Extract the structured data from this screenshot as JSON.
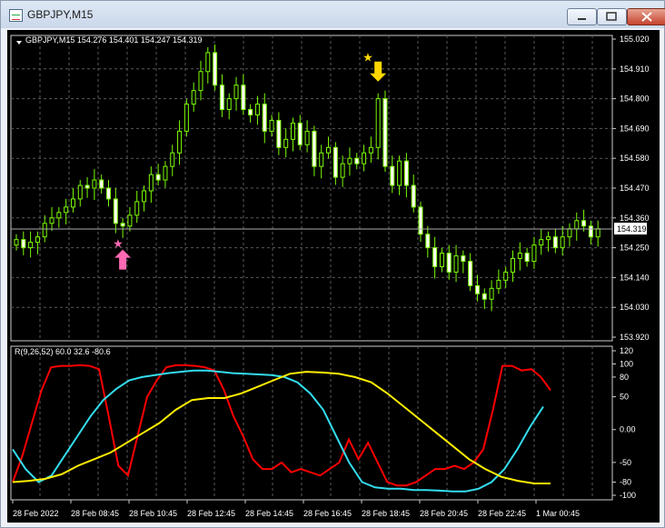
{
  "window": {
    "title": "GBPJPY,M15",
    "buttons": [
      "minimize",
      "maximize",
      "close"
    ]
  },
  "chart": {
    "header": "GBPJPY,M15  154.276 154.401 154.247 154.319",
    "price_axis": [
      "155.020",
      "154.910",
      "154.800",
      "154.690",
      "154.580",
      "154.470",
      "154.360",
      "154.250",
      "154.140",
      "154.030",
      "153.920"
    ],
    "current_price": "154.319",
    "time_axis": [
      "28 Feb 2022",
      "28 Feb 08:45",
      "28 Feb 10:45",
      "28 Feb 12:45",
      "28 Feb 14:45",
      "28 Feb 16:45",
      "28 Feb 18:45",
      "28 Feb 20:45",
      "28 Feb 22:45",
      "1 Mar 00:45"
    ],
    "indicator_header": "R(9,26,52) 60.0 32.6 -80.6",
    "indicator_axis": [
      "120",
      "100",
      "80",
      "50",
      "0.00",
      "-50",
      "-80",
      "-100"
    ]
  },
  "colors": {
    "background": "#000000",
    "candle": "#7CFC00",
    "grid": "#5a5a5a",
    "red_line": "#ff0000",
    "cyan_line": "#33ddee",
    "yellow_line": "#ffee00",
    "buy_arrow": "#ff69b4",
    "sell_arrow": "#ffd700"
  },
  "icons": {
    "buy": "pink-up-arrow-icon",
    "sell": "yellow-down-arrow-icon",
    "star": "star-icon"
  },
  "chart_data": {
    "type": "candlestick",
    "symbol": "GBPJPY",
    "timeframe": "M15",
    "ohlc_last": {
      "open": 154.276,
      "high": 154.401,
      "low": 154.247,
      "close": 154.319
    },
    "ylim": [
      153.92,
      155.02
    ],
    "close": [
      154.28,
      154.25,
      154.27,
      154.29,
      154.34,
      154.36,
      154.38,
      154.4,
      154.43,
      154.48,
      154.47,
      154.5,
      154.47,
      154.43,
      154.34,
      154.33,
      154.37,
      154.42,
      154.46,
      154.52,
      154.5,
      154.55,
      154.6,
      154.68,
      154.78,
      154.83,
      154.9,
      154.97,
      154.85,
      154.76,
      154.8,
      154.85,
      154.76,
      154.74,
      154.78,
      154.68,
      154.72,
      154.62,
      154.65,
      154.71,
      154.63,
      154.68,
      154.55,
      154.6,
      154.62,
      154.51,
      154.56,
      154.58,
      154.56,
      154.6,
      154.62,
      154.8,
      154.55,
      154.48,
      154.57,
      154.48,
      154.4,
      154.3,
      154.25,
      154.18,
      154.23,
      154.16,
      154.22,
      154.2,
      154.11,
      154.08,
      154.06,
      154.1,
      154.13,
      154.16,
      154.21,
      154.23,
      154.2,
      154.26,
      154.28,
      154.29,
      154.25,
      154.29,
      154.32,
      154.35,
      154.33,
      154.29,
      154.32
    ],
    "indicator": {
      "name": "R(9,26,52)",
      "values_shown": [
        60.0,
        32.6,
        -80.6
      ],
      "ylim": [
        -100,
        120
      ],
      "series": [
        {
          "color": "red",
          "values": [
            -80,
            -40,
            10,
            60,
            95,
            97,
            97,
            98,
            97,
            92,
            20,
            -55,
            -70,
            -10,
            50,
            75,
            95,
            98,
            98,
            97,
            95,
            90,
            60,
            20,
            -10,
            -45,
            -60,
            -60,
            -50,
            -65,
            -60,
            -65,
            -70,
            -60,
            -50,
            -15,
            -45,
            -20,
            -50,
            -80,
            -85,
            -85,
            -80,
            -70,
            -60,
            -60,
            -55,
            -60,
            -50,
            -30,
            30,
            97,
            97,
            90,
            92,
            80,
            60
          ]
        },
        {
          "color": "cyan",
          "values": [
            -30,
            -60,
            -80,
            -70,
            -40,
            -10,
            20,
            45,
            62,
            75,
            80,
            83,
            86,
            88,
            90,
            90,
            88,
            86,
            85,
            84,
            83,
            80,
            72,
            55,
            30,
            -10,
            -50,
            -80,
            -88,
            -90,
            -90,
            -92,
            -92,
            -93,
            -94,
            -94,
            -90,
            -80,
            -60,
            -30,
            5,
            35
          ]
        },
        {
          "color": "yellow",
          "values": [
            -80,
            -78,
            -75,
            -68,
            -55,
            -45,
            -35,
            -20,
            -5,
            10,
            30,
            45,
            48,
            48,
            55,
            65,
            75,
            85,
            88,
            87,
            85,
            80,
            72,
            55,
            35,
            15,
            -5,
            -25,
            -45,
            -60,
            -72,
            -78,
            -82,
            -82
          ]
        }
      ]
    }
  }
}
